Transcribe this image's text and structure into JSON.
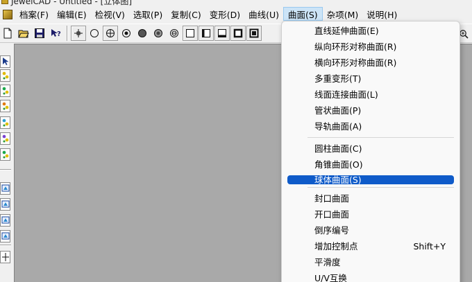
{
  "window": {
    "title": "JewelCAD - Untitled - [立体图]"
  },
  "menubar": {
    "items": [
      {
        "label": "档案(F)",
        "name": "menu-file"
      },
      {
        "label": "编辑(E)",
        "name": "menu-edit"
      },
      {
        "label": "检视(V)",
        "name": "menu-view"
      },
      {
        "label": "选取(P)",
        "name": "menu-select"
      },
      {
        "label": "复制(C)",
        "name": "menu-copy"
      },
      {
        "label": "变形(D)",
        "name": "menu-deform"
      },
      {
        "label": "曲线(U)",
        "name": "menu-curve"
      },
      {
        "label": "曲面(S)",
        "name": "menu-surface",
        "active": true
      },
      {
        "label": "杂项(M)",
        "name": "menu-misc"
      },
      {
        "label": "说明(H)",
        "name": "menu-help"
      }
    ]
  },
  "toolbar": {
    "buttons": [
      {
        "name": "new-file-icon"
      },
      {
        "name": "open-folder-icon"
      },
      {
        "name": "save-icon"
      },
      {
        "name": "context-help-icon"
      },
      {
        "name": "sep"
      },
      {
        "name": "crosshair-icon",
        "raised": true
      },
      {
        "name": "circle-icon"
      },
      {
        "name": "circle-cross-icon",
        "raised": true
      },
      {
        "name": "circle-dot-icon"
      },
      {
        "name": "filled-circle-icon"
      },
      {
        "name": "shaded-circle-icon"
      },
      {
        "name": "wire-circle-icon"
      },
      {
        "name": "square-icon",
        "raised": true
      },
      {
        "name": "square-left-icon",
        "raised": true
      },
      {
        "name": "square-bottom-icon",
        "raised": true
      },
      {
        "name": "square-bold-icon",
        "raised": true
      },
      {
        "name": "square-filled-icon",
        "raised": true
      }
    ],
    "zoom_icon": "zoom-icon"
  },
  "left_toolbar": {
    "buttons": [
      "select-arrow-icon",
      "color-select-icon",
      "layer-select-icon",
      "point-select-icon",
      "node-select-icon",
      "curve-select-icon",
      "group-select-icon",
      "sep",
      "front-view-icon",
      "top-view-icon",
      "side-view-icon",
      "perspective-view-icon",
      "sep",
      "axis-icon"
    ]
  },
  "surface_menu": {
    "groups": [
      [
        {
          "label": "直线延伸曲面(E)",
          "name": "item-linear-extrude"
        },
        {
          "label": "纵向环形对称曲面(R)",
          "name": "item-vertical-ring"
        },
        {
          "label": "横向环形对称曲面(R)",
          "name": "item-horizontal-ring"
        },
        {
          "label": "多重变形(T)",
          "name": "item-multi-deform"
        },
        {
          "label": "线面连接曲面(L)",
          "name": "item-line-surface-connect"
        },
        {
          "label": "管状曲面(P)",
          "name": "item-tube-surface"
        },
        {
          "label": "导轨曲面(A)",
          "name": "item-rail-surface"
        }
      ],
      [
        {
          "label": "圆柱曲面(C)",
          "name": "item-cylinder"
        },
        {
          "label": "角锥曲面(O)",
          "name": "item-cone"
        },
        {
          "label": "球体曲面(S)",
          "name": "item-sphere",
          "highlight": true
        }
      ],
      [
        {
          "label": "封口曲面",
          "name": "item-cap-surface"
        },
        {
          "label": "开口曲面",
          "name": "item-open-surface"
        },
        {
          "label": "倒序编号",
          "name": "item-reverse-numbering"
        },
        {
          "label": "增加控制点",
          "name": "item-add-control-point",
          "shortcut": "Shift+Y"
        },
        {
          "label": "平滑度",
          "name": "item-smoothness"
        },
        {
          "label": "U/V互换",
          "name": "item-uv-swap"
        }
      ]
    ]
  },
  "colors": {
    "canvas": "#a9a9a9",
    "highlight": "#0f5bc9",
    "menu_active": "#cce4f7"
  }
}
